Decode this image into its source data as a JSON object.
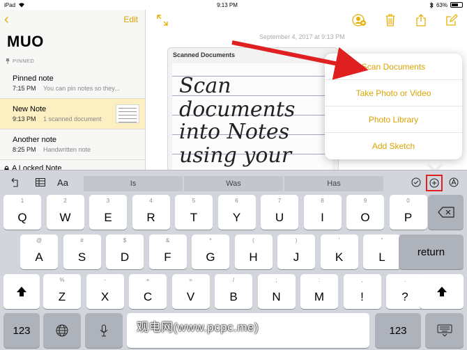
{
  "status_bar": {
    "device": "iPad",
    "time": "9:13 PM",
    "battery": "63%"
  },
  "sidebar": {
    "edit_label": "Edit",
    "folder_title": "MUO",
    "pinned_header": "PINNED",
    "notes": [
      {
        "title": "Pinned note",
        "time": "7:15 PM",
        "preview": "You can pin notes so they..."
      },
      {
        "title": "New Note",
        "time": "9:13 PM",
        "preview": "1 scanned document"
      },
      {
        "title": "Another note",
        "time": "8:25 PM",
        "preview": "Handwritten note"
      }
    ],
    "locked_title": "A Locked Note"
  },
  "note": {
    "date": "September 4, 2017 at 9:13 PM",
    "scan_label": "Scanned Documents",
    "handwriting": [
      "Scan",
      "documents",
      "into Notes",
      "using your"
    ]
  },
  "popover": {
    "items": [
      "Scan Documents",
      "Take Photo or Video",
      "Photo Library",
      "Add Sketch"
    ]
  },
  "keyboard": {
    "suggestions": [
      "Is",
      "Was",
      "Has"
    ],
    "row1": [
      {
        "k": "Q",
        "s": "1"
      },
      {
        "k": "W",
        "s": "2"
      },
      {
        "k": "E",
        "s": "3"
      },
      {
        "k": "R",
        "s": "4"
      },
      {
        "k": "T",
        "s": "5"
      },
      {
        "k": "Y",
        "s": "6"
      },
      {
        "k": "U",
        "s": "7"
      },
      {
        "k": "I",
        "s": "8"
      },
      {
        "k": "O",
        "s": "9"
      },
      {
        "k": "P",
        "s": "0"
      }
    ],
    "row2": [
      {
        "k": "A",
        "s": "@"
      },
      {
        "k": "S",
        "s": "#"
      },
      {
        "k": "D",
        "s": "$"
      },
      {
        "k": "F",
        "s": "&"
      },
      {
        "k": "G",
        "s": "*"
      },
      {
        "k": "H",
        "s": "("
      },
      {
        "k": "J",
        "s": ")"
      },
      {
        "k": "K",
        "s": "'"
      },
      {
        "k": "L",
        "s": "\""
      }
    ],
    "row3": [
      {
        "k": "Z",
        "s": "%"
      },
      {
        "k": "X",
        "s": "-"
      },
      {
        "k": "C",
        "s": "+"
      },
      {
        "k": "V",
        "s": "="
      },
      {
        "k": "B",
        "s": "/"
      },
      {
        "k": "N",
        "s": ";"
      },
      {
        "k": "M",
        "s": ":"
      },
      {
        "k": "!",
        "s": ","
      },
      {
        "k": "?",
        "s": "."
      }
    ],
    "return_label": "return",
    "numbers_label": "123"
  },
  "watermark": "观电网(www.pcpc.me)",
  "colors": {
    "accent": "#e6b000",
    "highlight_box": "#e02020",
    "arrow": "#e02020"
  }
}
